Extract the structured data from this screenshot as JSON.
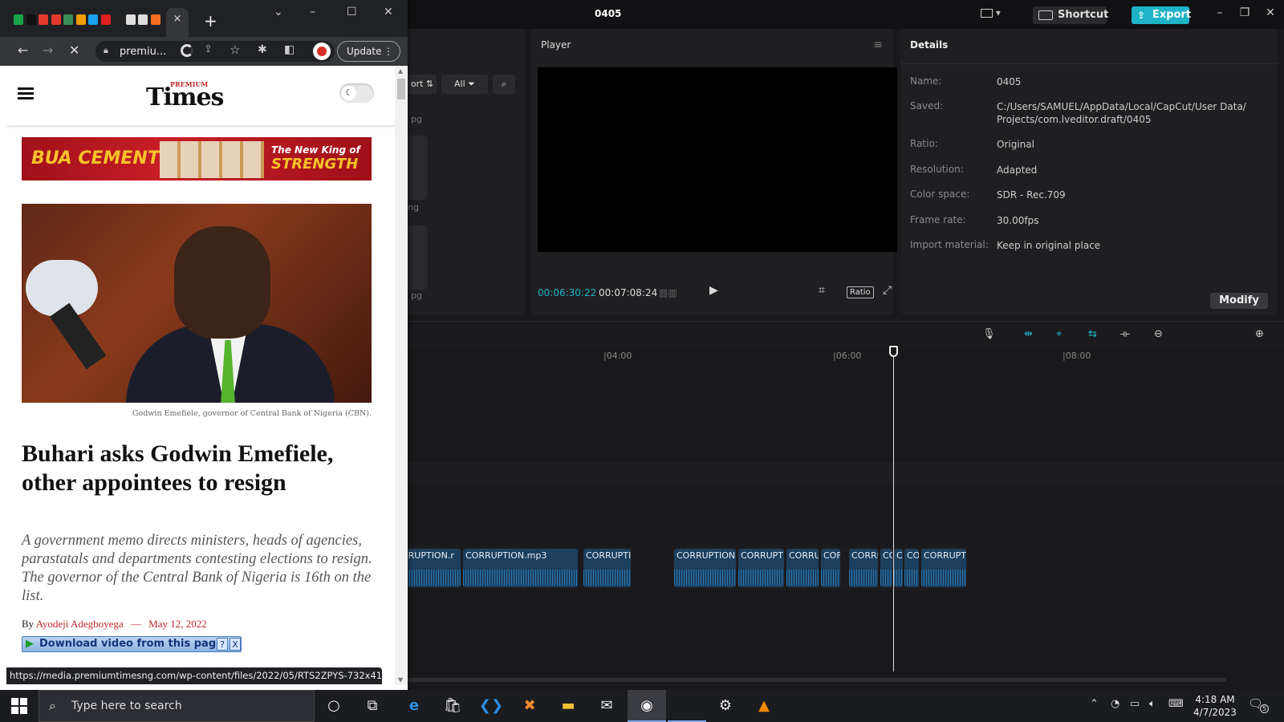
{
  "capcut": {
    "project_title": "0405",
    "shortcut_label": "Shortcut",
    "export_label": "Export",
    "media": {
      "sort_label": "ort",
      "filter_all_label": "All",
      "ghost_labels": [
        "pg",
        "ng",
        "pg"
      ]
    },
    "player": {
      "title": "Player",
      "current_time": "00:06:30:22",
      "total_time": "00:07:08:24",
      "ratio_label": "Ratio"
    },
    "details": {
      "title": "Details",
      "rows": [
        {
          "label": "Name:",
          "value": "0405"
        },
        {
          "label": "Saved:",
          "value": "C:/Users/SAMUEL/AppData/Local/CapCut/User Data/ Projects/com.lveditor.draft/0405"
        },
        {
          "label": "Ratio:",
          "value": "Original"
        },
        {
          "label": "Resolution:",
          "value": "Adapted"
        },
        {
          "label": "Color space:",
          "value": "SDR - Rec.709"
        },
        {
          "label": "Frame rate:",
          "value": "30.00fps"
        },
        {
          "label": "Import material:",
          "value": "Keep in original place"
        }
      ],
      "modify_label": "Modify"
    },
    "timeline": {
      "ticks": [
        "|04:00",
        "|06:00",
        "|08:00"
      ],
      "zoom_level": 0.25,
      "clips": [
        "RRUPTION.r",
        "CORRUPTION.mp3",
        "CORRUPTIC",
        "CORRUPTION.",
        "CORRUPTI",
        "CORRU",
        "COF",
        "CORRI",
        "CO",
        "C",
        "CO",
        "CORRUPTI"
      ]
    }
  },
  "chrome": {
    "tab_close": "×",
    "new_tab": "+",
    "address": "premiu...",
    "update_label": "Update",
    "status_url": "https://media.premiumtimesng.com/wp-content/files/2022/05/RTS2ZPYS-732x419-1...",
    "favicon_colors": [
      "#1aa34a",
      "#111",
      "#e23b2e",
      "#e23b2e",
      "#3a8f58",
      "#f29f05",
      "#1da1f2",
      "#e02020",
      "#222",
      "#ddd",
      "#ddd",
      "#f36f21"
    ]
  },
  "article": {
    "logo_small": "PREMIUM",
    "logo_main": "Times",
    "banner_left": "BUA CEMENT",
    "banner_right_top": "The New King of",
    "banner_right_bottom": "STRENGTH",
    "caption": "Godwin Emefiele, governor of Central Bank of Nigeria (CBN).",
    "headline": "Buhari asks Godwin Emefiele, other appointees to resign",
    "summary": "A government memo directs ministers, heads of agencies, parastatals and departments contesting elections to resign. The governor of the Central Bank of Nigeria is 16th on the list.",
    "by": "By",
    "author": "Ayodeji Adegboyega",
    "dash": "—",
    "date": "May 12, 2022",
    "download_label": "Download video from this page",
    "help": "?",
    "close": "X"
  },
  "taskbar": {
    "search_placeholder": "Type here to search",
    "time": "4:18 AM",
    "date": "4/7/2023",
    "notification_count": "5"
  }
}
